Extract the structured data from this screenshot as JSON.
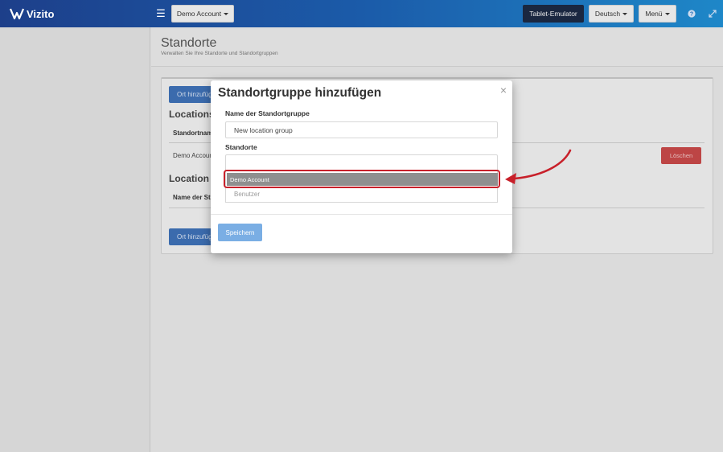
{
  "topbar": {
    "logo_text": "Vizito",
    "account_button": "Demo Account",
    "tablet_emulator": "Tablet-Emulator",
    "language": "Deutsch",
    "menu": "Menü"
  },
  "page": {
    "title": "Standorte",
    "subtitle": "Verwalten Sie Ihre Standorte und Standortgruppen"
  },
  "background": {
    "add_location_button": "Ort hinzufüg",
    "locations_title": "Locations",
    "location_name_header": "Standortnam",
    "location_row_name": "Demo Accoun",
    "delete_button": "Löschen",
    "location_groups_title": "Location gr",
    "group_name_header": "Name der Sta",
    "add_group_button": "Ort hinzufüg"
  },
  "modal": {
    "title": "Standortgruppe hinzufügen",
    "close": "×",
    "group_name_label": "Name der Standortgruppe",
    "group_name_value": "New location group",
    "locations_label": "Standorte",
    "locations_input_value": "",
    "dropdown_options": [
      "Demo Account",
      "Benutzer"
    ],
    "save_button": "Speichern"
  },
  "colors": {
    "topbar_start": "#1d3f8a",
    "topbar_end": "#1e87c8",
    "primary_button": "#3f72b8",
    "danger_button": "#c94a4a",
    "highlight": "#c8202a"
  },
  "icons": {
    "logo": "vizito-logo-icon",
    "hamburger": "hamburger-menu-icon",
    "help": "question-circle-icon",
    "fullscreen": "expand-icon",
    "close": "close-icon"
  }
}
